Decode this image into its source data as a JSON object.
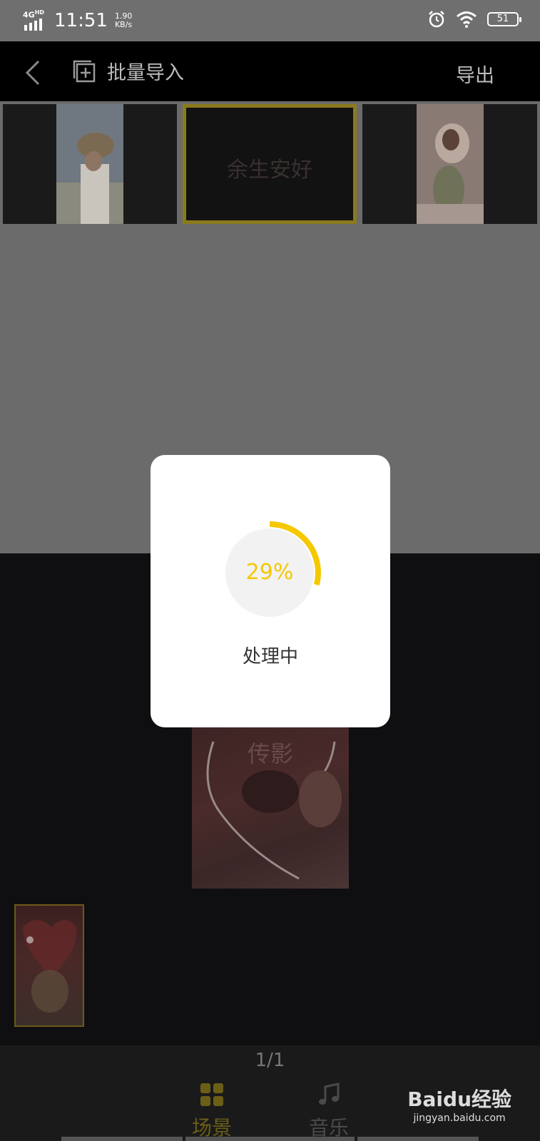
{
  "status_bar": {
    "network": "4G",
    "network_hd": "HD",
    "time": "11:51",
    "speed_value": "1.90",
    "speed_unit": "KB/s",
    "battery": "51"
  },
  "topnav": {
    "import_label": "批量导入",
    "export_label": "导出"
  },
  "scenes": {
    "text_card": "余生安好"
  },
  "preview": {
    "card_text": "传影"
  },
  "bottom": {
    "page_indicator": "1/1",
    "tab_scene": "场景",
    "tab_music": "音乐"
  },
  "watermark": {
    "brand": "Baidu经验",
    "url": "jingyan.baidu.com"
  },
  "modal": {
    "progress_percent": 29,
    "progress_label": "29%",
    "message": "处理中",
    "accent_color": "#f5c800"
  }
}
